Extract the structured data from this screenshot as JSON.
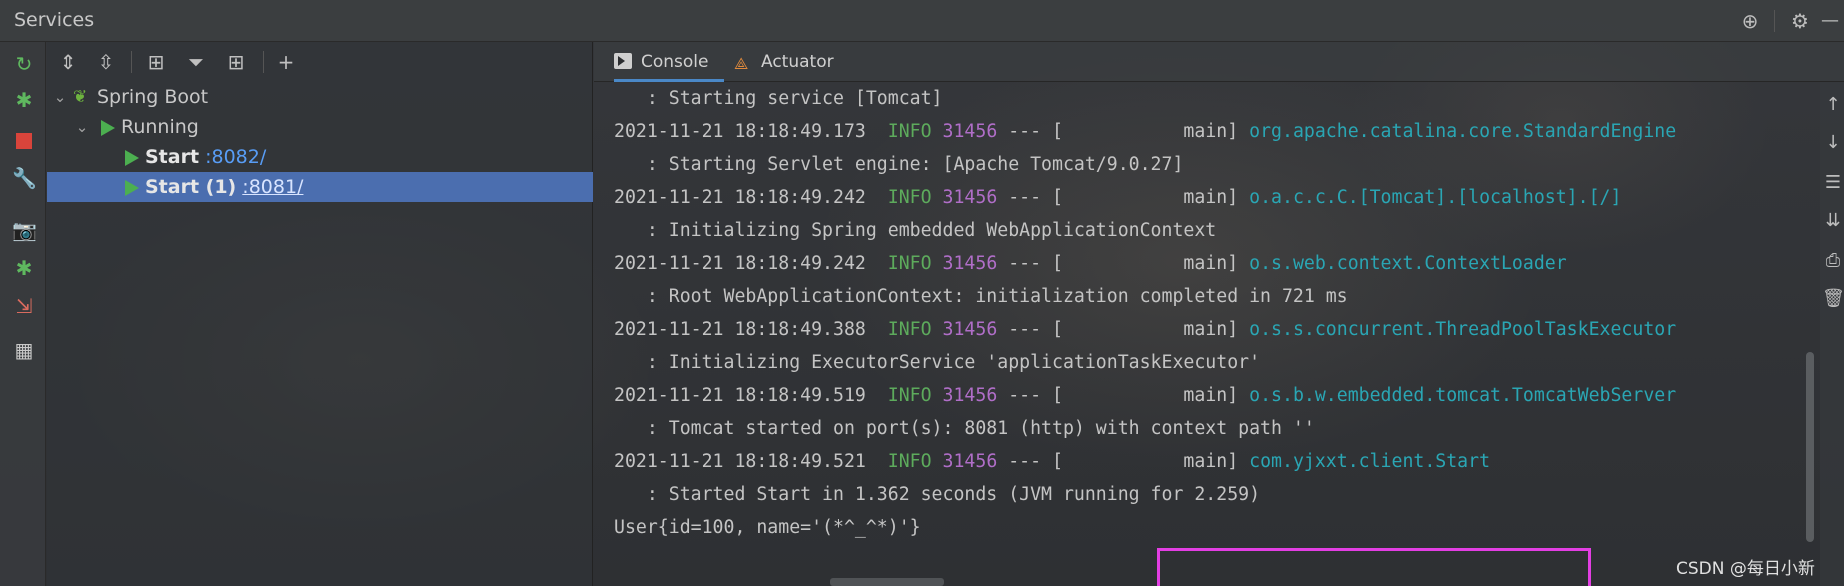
{
  "window": {
    "title": "Services"
  },
  "tree": {
    "root_label": "Spring Boot",
    "group_label": "Running",
    "items": [
      {
        "name": "Start",
        "port": ":8082/"
      },
      {
        "name": "Start (1)",
        "port": ":8081/",
        "selected": true
      }
    ]
  },
  "console": {
    "tabs": [
      {
        "label": "Console",
        "active": true
      },
      {
        "label": "Actuator",
        "active": false
      }
    ],
    "lines": [
      {
        "kind": "msg",
        "text": "   : Starting service [Tomcat]"
      },
      {
        "kind": "log",
        "date": "2021-11-21 18:18:49.173",
        "level": "INFO",
        "pid": "31456",
        "sep": " --- [           main] ",
        "logger": "org.apache.catalina.core.StandardEngine"
      },
      {
        "kind": "msg",
        "text": "   : Starting Servlet engine: [Apache Tomcat/9.0.27]"
      },
      {
        "kind": "log",
        "date": "2021-11-21 18:18:49.242",
        "level": "INFO",
        "pid": "31456",
        "sep": " --- [           main] ",
        "logger": "o.a.c.c.C.[Tomcat].[localhost].[/]"
      },
      {
        "kind": "msg",
        "text": "   : Initializing Spring embedded WebApplicationContext"
      },
      {
        "kind": "log",
        "date": "2021-11-21 18:18:49.242",
        "level": "INFO",
        "pid": "31456",
        "sep": " --- [           main] ",
        "logger": "o.s.web.context.ContextLoader"
      },
      {
        "kind": "msg",
        "text": "   : Root WebApplicationContext: initialization completed in 721 ms"
      },
      {
        "kind": "log",
        "date": "2021-11-21 18:18:49.388",
        "level": "INFO",
        "pid": "31456",
        "sep": " --- [           main] ",
        "logger": "o.s.s.concurrent.ThreadPoolTaskExecutor"
      },
      {
        "kind": "msg",
        "text": "   : Initializing ExecutorService 'applicationTaskExecutor'"
      },
      {
        "kind": "log",
        "date": "2021-11-21 18:18:49.519",
        "level": "INFO",
        "pid": "31456",
        "sep": " --- [           main] ",
        "logger": "o.s.b.w.embedded.tomcat.TomcatWebServer"
      },
      {
        "kind": "msg",
        "text": "   : Tomcat started on port(s): 8081 (http) with context path ''"
      },
      {
        "kind": "log",
        "date": "2021-11-21 18:18:49.521",
        "level": "INFO",
        "pid": "31456",
        "sep": " --- [           main] ",
        "logger": "com.yjxxt.client.Start"
      },
      {
        "kind": "msg",
        "text": "   : Started Start in 1.362 seconds (JVM running for 2.259)"
      },
      {
        "kind": "msg",
        "text": "User{id=100, name='(*^_^*)'}"
      }
    ]
  },
  "watermark": "CSDN @每日小新",
  "icons": {
    "titlebar": [
      "crosshair-icon",
      "gear-icon",
      "minimize-icon"
    ],
    "left_toolbar": [
      "rerun-icon",
      "debug-icon",
      "stop-icon",
      "wrench-icon",
      "camera-icon",
      "bug-icon",
      "exit-icon",
      "layout-icon"
    ],
    "tree_toolbar": [
      "expand-all-icon",
      "collapse-all-icon",
      "group-icon",
      "filter-icon",
      "new-service-icon",
      "add-icon"
    ],
    "right_strip": [
      "scroll-up-icon",
      "scroll-down-icon",
      "soft-wrap-icon",
      "scroll-to-end-icon",
      "print-icon",
      "trash-icon"
    ]
  }
}
